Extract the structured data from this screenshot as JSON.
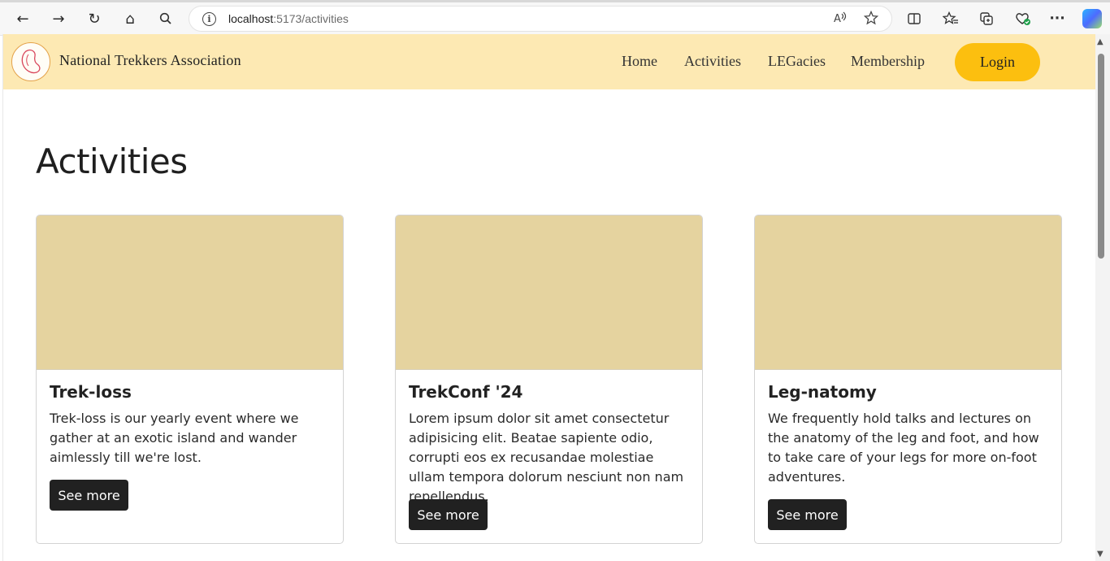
{
  "browser": {
    "url_host": "localhost",
    "url_path": ":5173/activities",
    "back_icon": "←",
    "forward_icon": "→",
    "reload_icon": "↻",
    "home_icon": "⌂",
    "search_icon": "⚲",
    "more_icon": "···"
  },
  "header": {
    "brand": "National Trekkers Association",
    "nav": [
      "Home",
      "Activities",
      "LEGacies",
      "Membership"
    ],
    "login": "Login",
    "bg_color": "#fde9b3",
    "login_color": "#fcbf0f"
  },
  "main": {
    "title": "Activities",
    "cards": [
      {
        "title": "Trek-loss",
        "text": "Trek-loss is our yearly event where we gather at an exotic island and wander aimlessly till we're lost.",
        "button": "See more"
      },
      {
        "title": "TrekConf '24",
        "text": "Lorem ipsum dolor sit amet consectetur adipisicing elit. Beatae sapiente odio, corrupti eos ex recusandae molestiae ullam tempora dolorum nesciunt non nam repellendus.",
        "button": "See more"
      },
      {
        "title": "Leg-natomy",
        "text": "We frequently hold talks and lectures on the anatomy of the leg and foot, and how to take care of your legs for more on-foot adventures.",
        "button": "See more"
      }
    ],
    "card_image_color": "#e5d39f",
    "button_color": "#212121"
  }
}
